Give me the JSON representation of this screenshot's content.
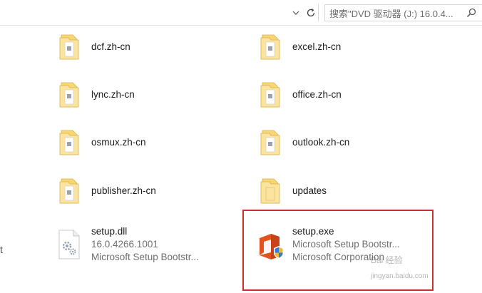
{
  "toolbar": {
    "search_placeholder": "搜索\"DVD 驱动器 (J:) 16.0.4..."
  },
  "left_edge_text": "t",
  "items": [
    {
      "name": "dcf.zh-cn",
      "type": "folder"
    },
    {
      "name": "excel.zh-cn",
      "type": "folder"
    },
    {
      "name": "lync.zh-cn",
      "type": "folder"
    },
    {
      "name": "office.zh-cn",
      "type": "folder"
    },
    {
      "name": "osmux.zh-cn",
      "type": "folder"
    },
    {
      "name": "outlook.zh-cn",
      "type": "folder"
    },
    {
      "name": "publisher.zh-cn",
      "type": "folder"
    },
    {
      "name": "updates",
      "type": "folder"
    },
    {
      "name": "setup.dll",
      "type": "dll",
      "line2": "16.0.4266.1001",
      "line3": "Microsoft Setup Bootstr..."
    },
    {
      "name": "setup.exe",
      "type": "exe",
      "line2": "Microsoft Setup Bootstr...",
      "line3": "Microsoft Corporation"
    }
  ],
  "watermark": {
    "line1": "Bai 经验",
    "line2": "jingyan.baidu.com"
  },
  "colors": {
    "highlight": "#c9302c",
    "folder": "#f5d06b",
    "office_red": "#e2531d"
  }
}
